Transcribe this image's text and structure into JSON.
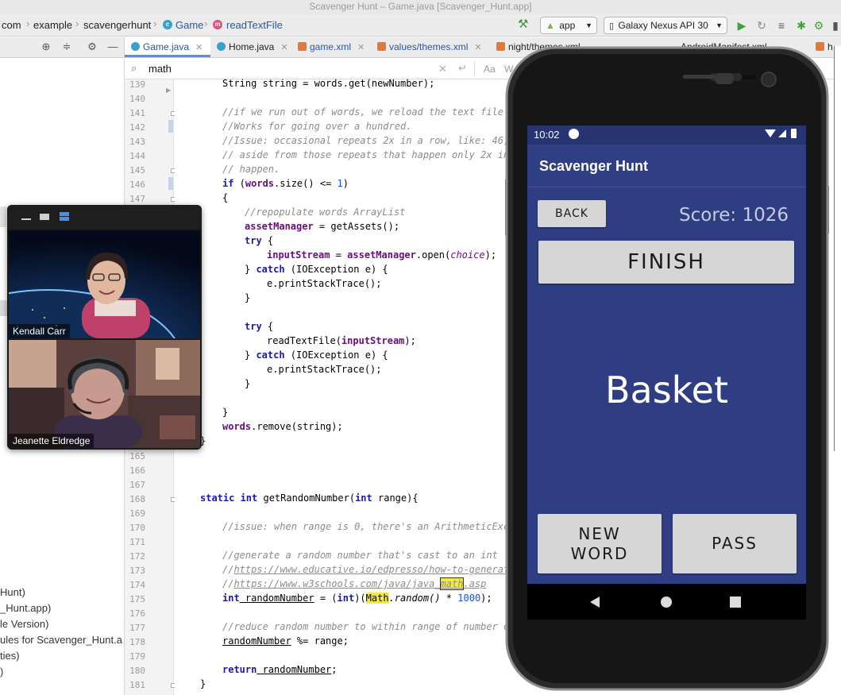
{
  "window": {
    "title": "Scavenger Hunt – Game.java [Scavenger_Hunt.app]"
  },
  "breadcrumb": {
    "items": [
      "com",
      "example",
      "scavengerhunt",
      "Game",
      "readTextFile"
    ]
  },
  "toolbar": {
    "run_config": "app",
    "device": "Galaxy Nexus API 30"
  },
  "tabs": [
    {
      "label": "Game.java"
    },
    {
      "label": "Home.java"
    },
    {
      "label": "game.xml"
    },
    {
      "label": "values/themes.xml"
    },
    {
      "label": "night/themes.xml"
    },
    {
      "label": "AndroidManifest.xml"
    },
    {
      "label": "h"
    }
  ],
  "search": {
    "value": "math",
    "match_case": "Aa",
    "words": "W"
  },
  "project_tree": [
    "Hunt)",
    "_Hunt.app)",
    "le Version)",
    "ules for Scavenger_Hunt.a",
    "ties)",
    ")"
  ],
  "line_numbers": [
    "139",
    "140",
    "141",
    "142",
    "143",
    "144",
    "145",
    "146",
    "147",
    "165",
    "166",
    "167",
    "168",
    "169",
    "170",
    "171",
    "172",
    "173",
    "174",
    "175",
    "176",
    "177",
    "178",
    "179",
    "180",
    "181"
  ],
  "code": {
    "l139": "String string = words.get(newNumber);",
    "l141": "//if we run out of words, we reload the text file i",
    "l142": "//Works for going over a hundred.",
    "l143": "//Issue: occasional repeats 2x in a row, like: 46,",
    "l144": "// aside from those repeats that happen only 2x in",
    "l145": "// happen.",
    "l146a": "if",
    "l146b": " (",
    "l146c": "words",
    "l146d": ".size() <= ",
    "l146e": "1",
    "l146f": ")",
    "l147": "{",
    "l148": "//repopulate words ArrayList",
    "l149a": "assetManager",
    "l149b": " = getAssets();",
    "l150": "try",
    "l150b": " {",
    "l151a": "inputStream",
    "l151b": " = ",
    "l151c": "assetManager",
    "l151d": ".open(",
    "l151e": "choice",
    "l151f": ");",
    "l152a": "} ",
    "l152b": "catch",
    "l152c": " (IOException e) {",
    "l153": "e.printStackTrace();",
    "l154": "}",
    "l156": "try",
    "l156b": " {",
    "l157a": "readTextFile(",
    "l157b": "inputStream",
    "l157c": ");",
    "l158a": "} ",
    "l158b": "catch",
    "l158c": " (IOException e) {",
    "l159": "e.printStackTrace();",
    "l160": "}",
    "l162": "}",
    "l163a": "words",
    "l163b": ".remove(string);",
    "l164": "}",
    "l168a": "static int",
    "l168b": " getRandomNumber(",
    "l168c": "int",
    "l168d": " range){",
    "l170": "//issue: when range is 0, there's an ArithmeticExce",
    "l172": "//generate a random number that's cast to an int",
    "l173a": "//",
    "l173b": "https://www.educative.io/edpresso/how-to-generate",
    "l174a": "//",
    "l174b": "https://www.w3schools.com/java/java_",
    "l174c": "math",
    "l174d": ".asp",
    "l175a": "int",
    "l175b": " randomNumber",
    "l175c": " = (",
    "l175d": "int",
    "l175e": ")(",
    "l175f": "Math",
    "l175g": ".random() * ",
    "l175h": "1000",
    "l175i": ");",
    "l177": "//reduce random number to within range of number of",
    "l178a": "randomNumber",
    "l178b": " %= range;",
    "l180a": "return",
    "l180b": " randomNumber",
    "l180c": ";",
    "l181": "}"
  },
  "video_call": {
    "participants": [
      {
        "name": "Kendall Carr"
      },
      {
        "name": "Jeanette Eldredge"
      }
    ]
  },
  "phone": {
    "status_time": "10:02",
    "app_title": "Scavenger Hunt",
    "back_label": "BACK",
    "score": "Score: 1026",
    "finish_label": "FINISH",
    "word": "Basket",
    "new_word_line1": "NEW",
    "new_word_line2": "WORD",
    "pass_label": "PASS"
  },
  "colors": {
    "app_background": "#2f3e82",
    "button_gray": "#d6d6d6",
    "keyword": "#1a1aa6",
    "highlight": "#f6eb3b"
  }
}
